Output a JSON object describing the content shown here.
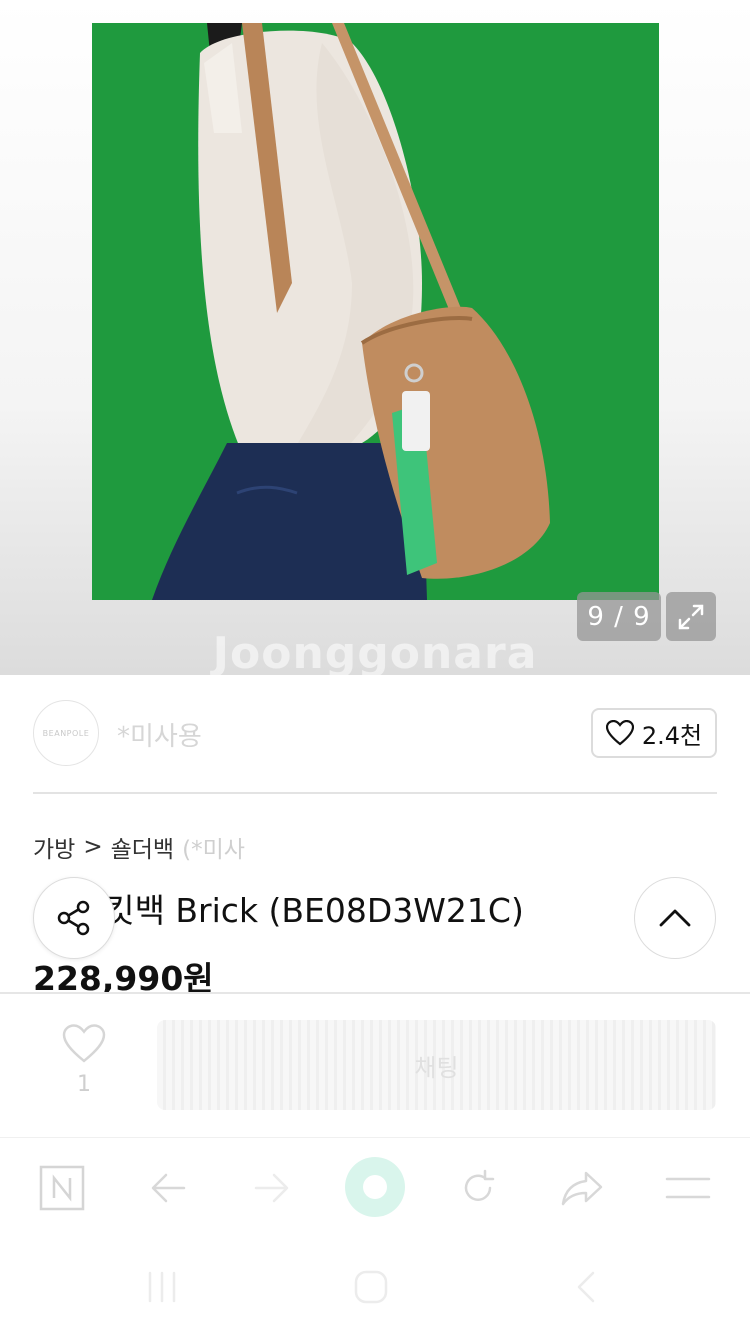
{
  "gallery": {
    "counter": "9 / 9",
    "watermark": "Joonggonara",
    "colors": {
      "backdrop": "#1f9a3e",
      "bag": "#c08c5f",
      "strap": "#3ec47a"
    }
  },
  "seller": {
    "avatar_text": "BEANPOLE",
    "name": "*미사용",
    "like_count": "2.4천"
  },
  "product": {
    "breadcrumb": [
      "가방",
      "숄더백"
    ],
    "breadcrumb_sep": ">",
    "breadcrumb_ghost": "(*미사",
    "title": "사 버킷백 Brick (BE08D3W21C)",
    "price": "228,990원"
  },
  "action_bar": {
    "heart_count": "1",
    "chat_label": "채팅"
  },
  "icons": {
    "share": "share-icon",
    "up": "chevron-up-icon",
    "expand": "expand-icon",
    "heart": "heart-icon"
  }
}
